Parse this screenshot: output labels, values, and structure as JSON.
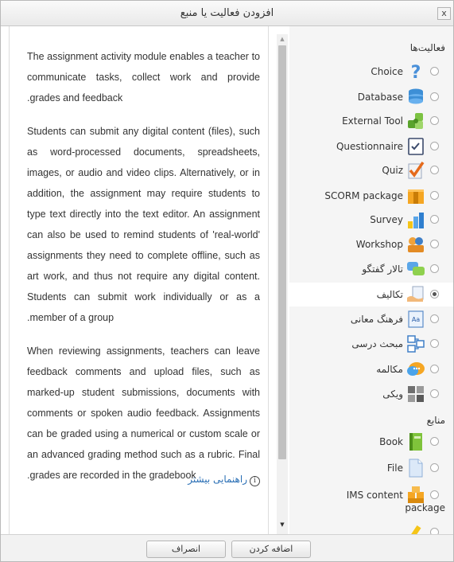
{
  "dialog": {
    "title": "افزودن فعالیت یا منبع",
    "close_label": "x"
  },
  "description": {
    "paragraphs": [
      "The assignment activity module enables a teacher to communicate tasks, collect work and provide .grades and feedback",
      "Students can submit any digital content (files), such as word-processed documents, spreadsheets, images, or audio and video clips. Alternatively, or in addition, the assignment may require students to type text directly into the text editor. An assignment can also be used to remind students of 'real-world' assignments they need to complete offline, such as art work, and thus not require any digital content. Students can submit work individually or as a .member of a group",
      "When reviewing assignments, teachers can leave feedback comments and upload files, such as marked-up student submissions, documents with comments or spoken audio feedback. Assignments can be graded using a numerical or custom scale or an advanced grading method such as a rubric. Final .grades are recorded in the gradebook"
    ],
    "more_help": "راهنمایی بیشتر"
  },
  "activities_label": "فعالیت‌ها",
  "resources_label": "منابع",
  "activities": [
    {
      "label": "Choice",
      "icon": "choice-icon",
      "selected": false
    },
    {
      "label": "Database",
      "icon": "database-icon",
      "selected": false
    },
    {
      "label": "External Tool",
      "icon": "external-tool-icon",
      "selected": false
    },
    {
      "label": "Questionnaire",
      "icon": "questionnaire-icon",
      "selected": false
    },
    {
      "label": "Quiz",
      "icon": "quiz-icon",
      "selected": false
    },
    {
      "label": "SCORM package",
      "icon": "scorm-icon",
      "selected": false
    },
    {
      "label": "Survey",
      "icon": "survey-icon",
      "selected": false
    },
    {
      "label": "Workshop",
      "icon": "workshop-icon",
      "selected": false
    },
    {
      "label": "تالار گفتگو",
      "icon": "forum-icon",
      "selected": false
    },
    {
      "label": "تکالیف",
      "icon": "assignment-icon",
      "selected": true
    },
    {
      "label": "فرهنگ معانی",
      "icon": "glossary-icon",
      "selected": false
    },
    {
      "label": "مبحث درسی",
      "icon": "lesson-icon",
      "selected": false
    },
    {
      "label": "مکالمه",
      "icon": "chat-icon",
      "selected": false
    },
    {
      "label": "ویکی",
      "icon": "wiki-icon",
      "selected": false
    }
  ],
  "resources": [
    {
      "label": "Book",
      "icon": "book-icon"
    },
    {
      "label": "File",
      "icon": "file-icon"
    },
    {
      "label": "IMS content",
      "label2": "package",
      "icon": "ims-package-icon"
    }
  ],
  "buttons": {
    "add": "اضافه کردن",
    "cancel": "انصراف"
  }
}
